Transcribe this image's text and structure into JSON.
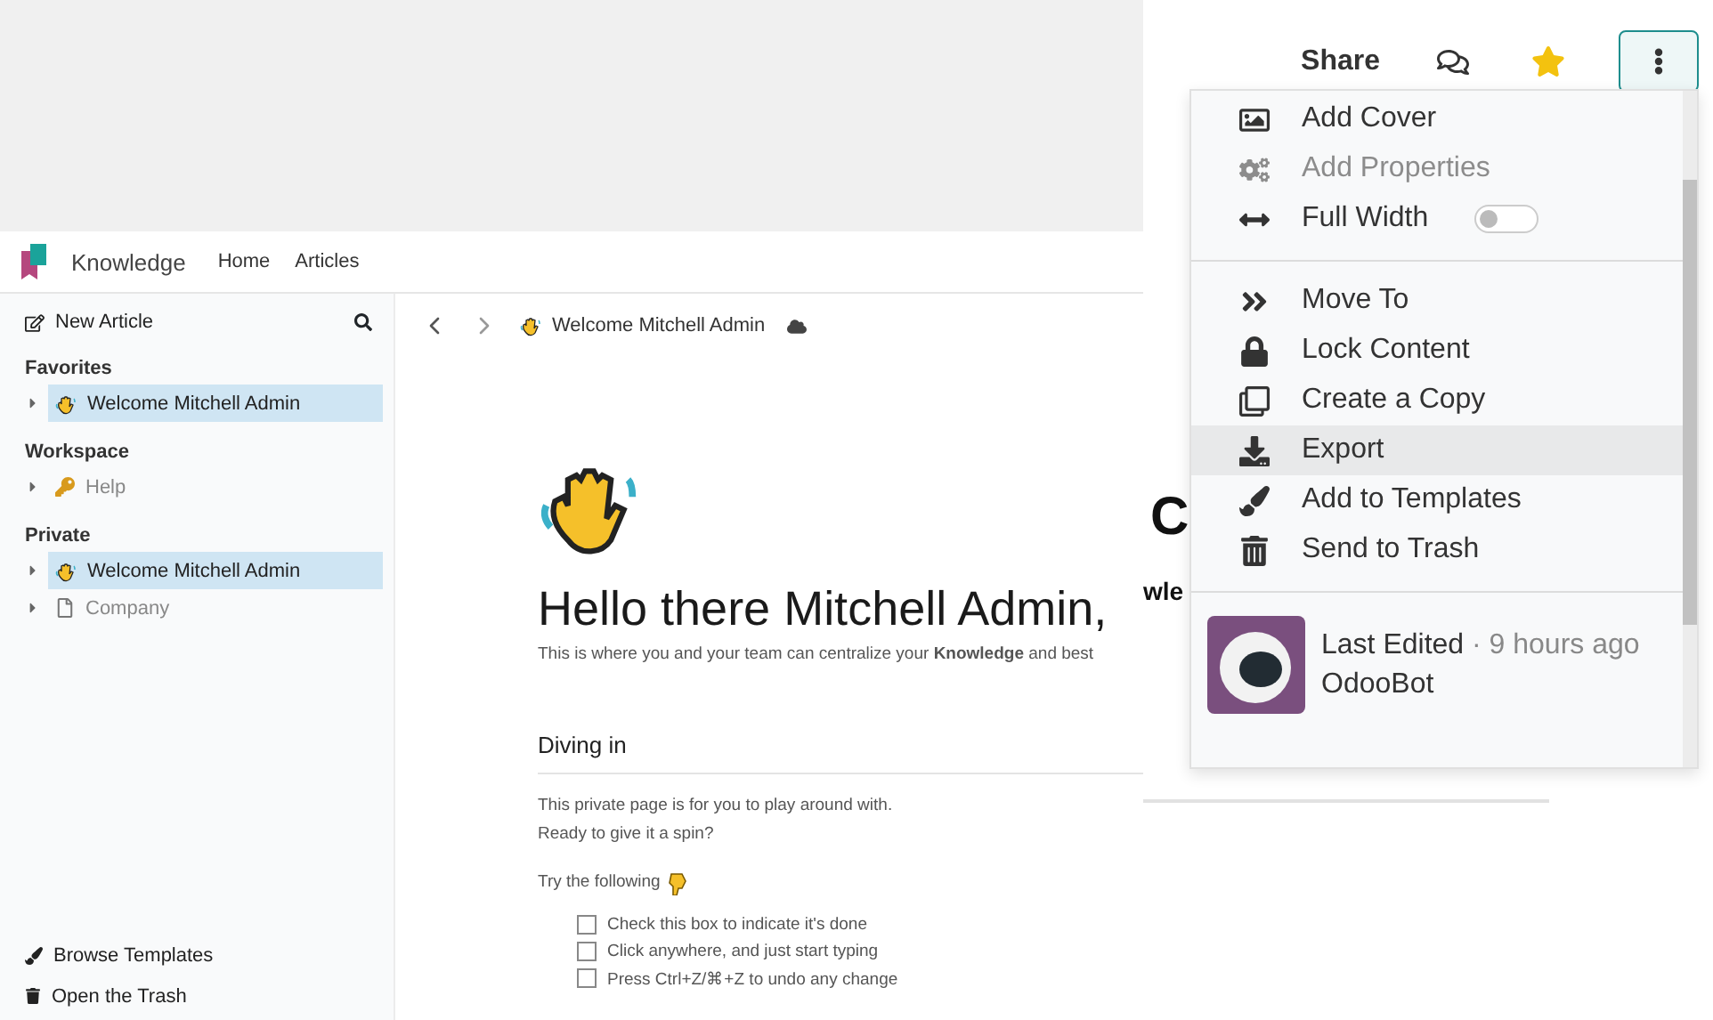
{
  "top_bar": {
    "app_name": "Knowledge",
    "nav": [
      {
        "label": "Home"
      },
      {
        "label": "Articles"
      }
    ]
  },
  "sidebar": {
    "new_article": "New Article",
    "sections": [
      {
        "title": "Favorites",
        "items": [
          {
            "label": "Welcome Mitchell Admin",
            "kind": "wave",
            "selected": true
          }
        ]
      },
      {
        "title": "Workspace",
        "items": [
          {
            "label": "Help",
            "kind": "key",
            "selected": false
          }
        ]
      },
      {
        "title": "Private",
        "items": [
          {
            "label": "Welcome Mitchell Admin",
            "kind": "wave",
            "selected": true
          },
          {
            "label": "Company",
            "kind": "page",
            "selected": false
          }
        ]
      }
    ],
    "footer": [
      {
        "label": "Browse Templates",
        "kind": "brush"
      },
      {
        "label": "Open the Trash",
        "kind": "trash"
      }
    ]
  },
  "breadcrumb": {
    "title": "Welcome Mitchell Admin"
  },
  "article": {
    "heading": "Hello there Mitchell Admin,",
    "subtitle": "This is where you and your team can centralize your **Knowledge** and best",
    "section_title": "Diving in",
    "paragraphs": [
      "This private page is for you to play around with.",
      "Ready to give it a spin?"
    ],
    "try_text": "Try the following",
    "checklist": [
      {
        "label": "Check this box to indicate it's done",
        "checked": false
      },
      {
        "label": "Click anywhere, and just start typing",
        "checked": false
      },
      {
        "label": "Press Ctrl+Z/⌘+Z to undo any change",
        "checked": false
      }
    ]
  },
  "zoomed_toolbar": {
    "share": "Share",
    "starred": true
  },
  "behind_text": [
    "C",
    "wle"
  ],
  "menu": {
    "items": [
      {
        "kind": "action",
        "label": "Add Cover",
        "disabled": false,
        "selected": false
      },
      {
        "kind": "action",
        "label": "Add Properties",
        "disabled": true,
        "selected": false
      },
      {
        "kind": "toggle",
        "label": "Full Width",
        "on": false
      },
      {
        "kind": "divider"
      },
      {
        "kind": "action",
        "label": "Move To",
        "disabled": false,
        "selected": false
      },
      {
        "kind": "action",
        "label": "Lock Content",
        "disabled": false,
        "selected": false
      },
      {
        "kind": "action",
        "label": "Create a Copy",
        "disabled": false,
        "selected": false
      },
      {
        "kind": "action",
        "label": "Export",
        "disabled": false,
        "selected": true
      },
      {
        "kind": "action",
        "label": "Add to Templates",
        "disabled": false,
        "selected": false
      },
      {
        "kind": "action",
        "label": "Send to Trash",
        "disabled": false,
        "selected": false
      },
      {
        "kind": "divider"
      }
    ],
    "last_edited": {
      "label": "Last Edited",
      "time": "· 9 hours ago",
      "author": "OdooBot"
    }
  }
}
